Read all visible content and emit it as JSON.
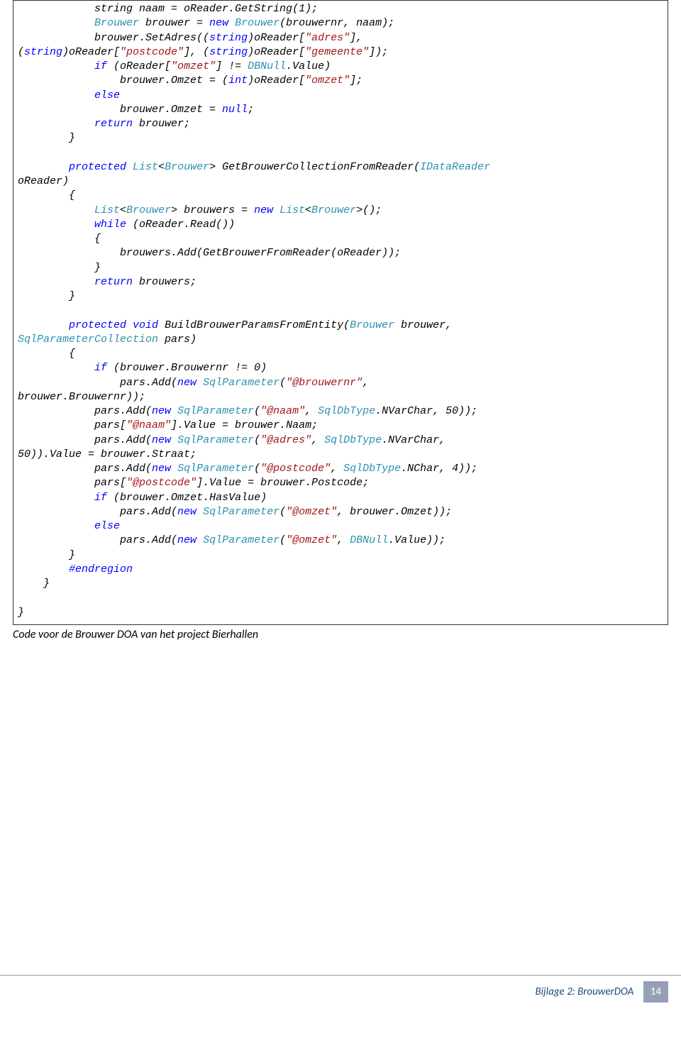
{
  "code": {
    "l1": "            string naam = oReader.GetString(1);",
    "l2a": "            ",
    "l2b": "Brouwer",
    "l2c": " brouwer = ",
    "l2d": "new",
    "l2e": " ",
    "l2f": "Brouwer",
    "l2g": "(brouwernr, naam);",
    "l3a": "            brouwer.SetAdres((",
    "l3b": "string",
    "l3c": ")oReader[",
    "l3d": "\"adres\"",
    "l3e": "], ",
    "l4a": "(",
    "l4b": "string",
    "l4c": ")oReader[",
    "l4d": "\"postcode\"",
    "l4e": "], (",
    "l4f": "string",
    "l4g": ")oReader[",
    "l4h": "\"gemeente\"",
    "l4i": "]);",
    "l5a": "            ",
    "l5b": "if",
    "l5c": " (oReader[",
    "l5d": "\"omzet\"",
    "l5e": "] != ",
    "l5f": "DBNull",
    "l5g": ".Value)",
    "l6a": "                brouwer.Omzet = (",
    "l6b": "int",
    "l6c": ")oReader[",
    "l6d": "\"omzet\"",
    "l6e": "];",
    "l7a": "            ",
    "l7b": "else",
    "l8a": "                brouwer.Omzet = ",
    "l8b": "null",
    "l8c": ";",
    "l9a": "            ",
    "l9b": "return",
    "l9c": " brouwer;",
    "l10": "        }",
    "l11": "",
    "l12a": "        ",
    "l12b": "protected",
    "l12c": " ",
    "l12d": "List",
    "l12e": "<",
    "l12f": "Brouwer",
    "l12g": "> GetBrouwerCollectionFromReader(",
    "l12h": "IDataReader",
    "l13": "oReader)",
    "l14": "        {",
    "l15a": "            ",
    "l15b": "List",
    "l15c": "<",
    "l15d": "Brouwer",
    "l15e": "> brouwers = ",
    "l15f": "new",
    "l15g": " ",
    "l15h": "List",
    "l15i": "<",
    "l15j": "Brouwer",
    "l15k": ">();",
    "l16a": "            ",
    "l16b": "while",
    "l16c": " (oReader.Read())",
    "l17": "            {",
    "l18": "                brouwers.Add(GetBrouwerFromReader(oReader));",
    "l19": "            }",
    "l20a": "            ",
    "l20b": "return",
    "l20c": " brouwers;",
    "l21": "        }",
    "l22": "",
    "l23a": "        ",
    "l23b": "protected",
    "l23c": " ",
    "l23d": "void",
    "l23e": " BuildBrouwerParamsFromEntity(",
    "l23f": "Brouwer",
    "l23g": " brouwer, ",
    "l24a": "SqlParameterCollection",
    "l24b": " pars)",
    "l25": "        {",
    "l26a": "            ",
    "l26b": "if",
    "l26c": " (brouwer.Brouwernr != 0)",
    "l27a": "                pars.Add(",
    "l27b": "new",
    "l27c": " ",
    "l27d": "SqlParameter",
    "l27e": "(",
    "l27f": "\"@brouwernr\"",
    "l27g": ", ",
    "l28": "brouwer.Brouwernr));",
    "l29a": "            pars.Add(",
    "l29b": "new",
    "l29c": " ",
    "l29d": "SqlParameter",
    "l29e": "(",
    "l29f": "\"@naam\"",
    "l29g": ", ",
    "l29h": "SqlDbType",
    "l29i": ".NVarChar, 50));",
    "l30a": "            pars[",
    "l30b": "\"@naam\"",
    "l30c": "].Value = brouwer.Naam;",
    "l31a": "            pars.Add(",
    "l31b": "new",
    "l31c": " ",
    "l31d": "SqlParameter",
    "l31e": "(",
    "l31f": "\"@adres\"",
    "l31g": ", ",
    "l31h": "SqlDbType",
    "l31i": ".NVarChar, ",
    "l32": "50)).Value = brouwer.Straat;",
    "l33a": "            pars.Add(",
    "l33b": "new",
    "l33c": " ",
    "l33d": "SqlParameter",
    "l33e": "(",
    "l33f": "\"@postcode\"",
    "l33g": ", ",
    "l33h": "SqlDbType",
    "l33i": ".NChar, 4));",
    "l34a": "            pars[",
    "l34b": "\"@postcode\"",
    "l34c": "].Value = brouwer.Postcode;",
    "l35a": "            ",
    "l35b": "if",
    "l35c": " (brouwer.Omzet.HasValue)",
    "l36a": "                pars.Add(",
    "l36b": "new",
    "l36c": " ",
    "l36d": "SqlParameter",
    "l36e": "(",
    "l36f": "\"@omzet\"",
    "l36g": ", brouwer.Omzet));",
    "l37a": "            ",
    "l37b": "else",
    "l38a": "                pars.Add(",
    "l38b": "new",
    "l38c": " ",
    "l38d": "SqlParameter",
    "l38e": "(",
    "l38f": "\"@omzet\"",
    "l38g": ", ",
    "l38h": "DBNull",
    "l38i": ".Value));",
    "l39": "        }",
    "l40a": "        ",
    "l40b": "#endregion",
    "l41": "    }",
    "l42": "",
    "l43": "}"
  },
  "caption": "Code voor de Brouwer DOA van het project Bierhallen",
  "footer": {
    "label": "Bijlage 2: BrouwerDOA",
    "page": "14"
  }
}
